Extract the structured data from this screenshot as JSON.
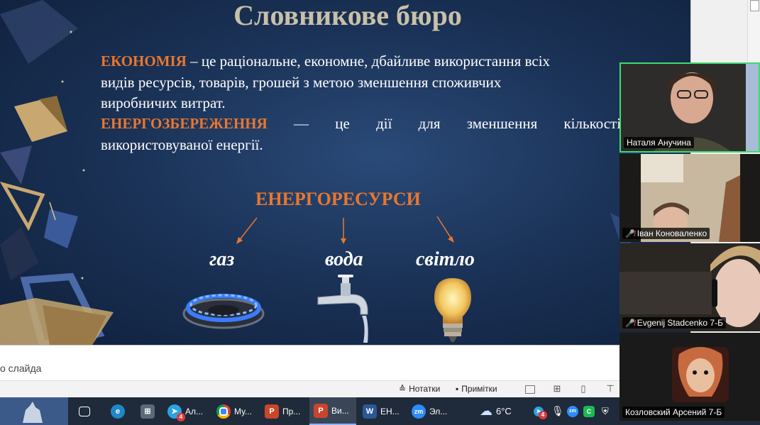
{
  "slide": {
    "title": "Словникове бюро",
    "paragraph1": {
      "term": "ЕКОНОМІЯ",
      "line1_rest": " – це раціональне, економне, дбайливе використання всіх",
      "line2": "видів ресурсів, товарів, грошей з метою зменшення споживчих",
      "line3": "виробничих витрат."
    },
    "paragraph2": {
      "term": "ЕНЕРГОЗБЕРЕЖЕННЯ",
      "line1_rest": " — це дії для зменшення кількості",
      "line2": "використовуваної енергії."
    },
    "resources_title": "ЕНЕРГОРЕСУРСИ",
    "resources": [
      "газ",
      "вода",
      "світло"
    ],
    "colors": {
      "accent": "#e8772e",
      "text": "#ffffff",
      "title": "#c8c0a8",
      "background": "#1b3358"
    }
  },
  "notes": {
    "placeholder": "о слайда"
  },
  "status_bar": {
    "notes_label": "Нотатки",
    "comments_label": "Примітки"
  },
  "taskbar": {
    "items": [
      {
        "label": "Ал...",
        "icon": "telegram-icon",
        "badge": "4"
      },
      {
        "label": "Му...",
        "icon": "chrome-icon"
      },
      {
        "label": "Пр...",
        "icon": "powerpoint-icon"
      },
      {
        "label": "Ви...",
        "icon": "powerpoint-icon"
      },
      {
        "label": "ЕН...",
        "icon": "word-icon"
      },
      {
        "label": "Эл...",
        "icon": "zoom-icon"
      }
    ],
    "weather": "6°C",
    "tray_badge": "4"
  },
  "participants": [
    {
      "name": "Наталя Анучина",
      "muted": false,
      "active": true
    },
    {
      "name": "Іван Коноваленко",
      "muted": true
    },
    {
      "name": "Evgenij Stadcenko 7-Б",
      "muted": true
    },
    {
      "name": "Козловский Арсений 7-Б",
      "muted": false
    }
  ]
}
